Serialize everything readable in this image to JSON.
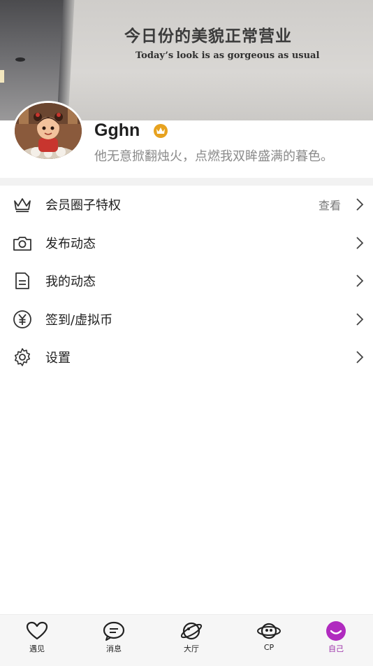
{
  "cover": {
    "headline_cn": "今日份的美貌正常营业",
    "headline_en": "Today’s look is as gorgeous as usual"
  },
  "profile": {
    "username": "Gghn",
    "signature": "他无意掀翻烛火，点燃我双眸盛满的暮色。",
    "badge_icon": "crown-badge-icon"
  },
  "menu": {
    "items": [
      {
        "label": "会员圈子特权",
        "extra": "查看",
        "icon": "crown-icon"
      },
      {
        "label": "发布动态",
        "extra": "",
        "icon": "camera-icon"
      },
      {
        "label": "我的动态",
        "extra": "",
        "icon": "document-icon"
      },
      {
        "label": "签到/虚拟币",
        "extra": "",
        "icon": "yen-coin-icon"
      },
      {
        "label": "设置",
        "extra": "",
        "icon": "gear-icon"
      }
    ]
  },
  "tabbar": {
    "tabs": [
      {
        "label": "遇见",
        "icon": "heart-icon"
      },
      {
        "label": "消息",
        "icon": "chat-bubble-icon"
      },
      {
        "label": "大厅",
        "icon": "planet-icon"
      },
      {
        "label": "CP",
        "icon": "cp-planet-icon"
      },
      {
        "label": "自己",
        "icon": "smile-avatar-icon",
        "active": true
      }
    ]
  },
  "colors": {
    "accent": "#9b2fa8",
    "badge": "#e7a21f",
    "active_tab_icon": "#b02bbf"
  }
}
